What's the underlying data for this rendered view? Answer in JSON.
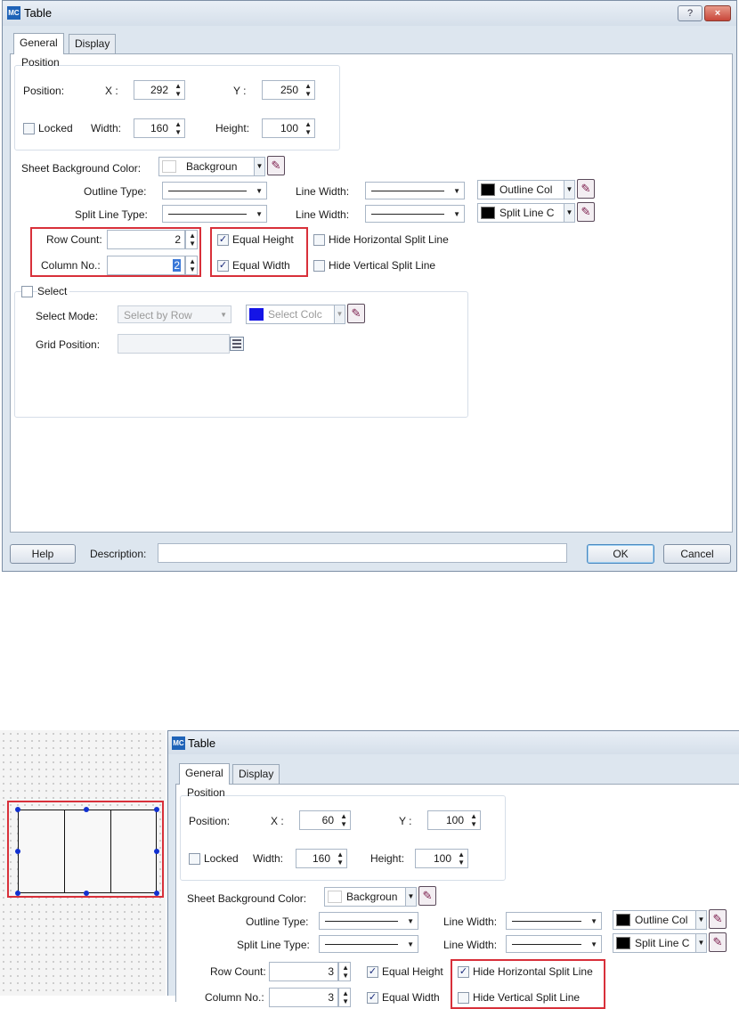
{
  "dialog1": {
    "title": "Table",
    "help_glyph": "?",
    "close_glyph": "×",
    "tabs": [
      {
        "label": "General"
      },
      {
        "label": "Display"
      }
    ],
    "position": {
      "group_label": "Position",
      "position_label": "Position:",
      "x_label": "X :",
      "x_value": "292",
      "y_label": "Y :",
      "y_value": "250",
      "locked_label": "Locked",
      "width_label": "Width:",
      "width_value": "160",
      "height_label": "Height:",
      "height_value": "100"
    },
    "sheet_bg_label": "Sheet Background Color:",
    "sheet_bg_value": "Backgroun",
    "outline_type_label": "Outline Type:",
    "outline_line_width_label": "Line Width:",
    "outline_color_value": "Outline Col",
    "split_line_type_label": "Split Line Type:",
    "split_line_width_label": "Line Width:",
    "split_color_value": "Split Line C",
    "row_count_label": "Row Count:",
    "row_count_value": "2",
    "column_no_label": "Column No.:",
    "column_no_value": "2",
    "equal_height_label": "Equal Height",
    "equal_width_label": "Equal Width",
    "hide_horizontal_label": "Hide Horizontal Split Line",
    "hide_vertical_label": "Hide Vertical Split Line",
    "select": {
      "label": "Select",
      "mode_label": "Select Mode:",
      "mode_value": "Select by Row",
      "color_value": "Select Colc",
      "grid_position_label": "Grid Position:"
    },
    "footer": {
      "help_label": "Help",
      "description_label": "Description:",
      "ok_label": "OK",
      "cancel_label": "Cancel"
    }
  },
  "dialog2": {
    "title": "Table",
    "tabs": [
      {
        "label": "General"
      },
      {
        "label": "Display"
      }
    ],
    "position": {
      "group_label": "Position",
      "position_label": "Position:",
      "x_label": "X :",
      "x_value": "60",
      "y_label": "Y :",
      "y_value": "100",
      "locked_label": "Locked",
      "width_label": "Width:",
      "width_value": "160",
      "height_label": "Height:",
      "height_value": "100"
    },
    "sheet_bg_label": "Sheet Background Color:",
    "sheet_bg_value": "Backgroun",
    "outline_type_label": "Outline Type:",
    "outline_line_width_label": "Line Width:",
    "outline_color_value": "Outline Col",
    "split_line_type_label": "Split Line Type:",
    "split_line_width_label": "Line Width:",
    "split_color_value": "Split Line C",
    "row_count_label": "Row Count:",
    "row_count_value": "3",
    "column_no_label": "Column No.:",
    "column_no_value": "3",
    "equal_height_label": "Equal Height",
    "equal_width_label": "Equal Width",
    "hide_horizontal_label": "Hide Horizontal Split Line",
    "hide_vertical_label": "Hide Vertical Split Line"
  },
  "colors": {
    "highlight": "#d8303a",
    "select_color": "#1414e6",
    "outline_color": "#000000",
    "handle": "#1030d0"
  }
}
